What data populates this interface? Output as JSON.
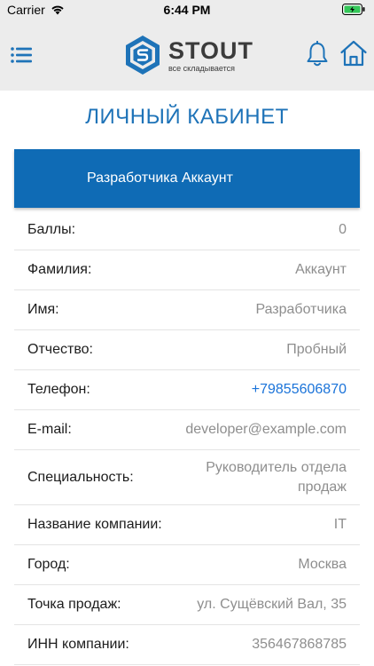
{
  "status_bar": {
    "carrier": "Carrier",
    "time": "6:44 PM"
  },
  "header": {
    "logo_title": "STOUT",
    "logo_subtitle": "все складывается",
    "icons": {
      "menu": "hamburger-menu-icon",
      "bell": "bell-icon",
      "home": "home-icon"
    },
    "colors": {
      "brand_blue": "#1e73b8",
      "header_bg": "#ececec"
    }
  },
  "page": {
    "title": "ЛИЧНЫЙ КАБИНЕТ",
    "banner_name": "Разработчика Аккаунт",
    "banner_color": "#0f6bb5"
  },
  "profile": {
    "fields": [
      {
        "label": "Баллы:",
        "value": "0"
      },
      {
        "label": "Фамилия:",
        "value": "Аккаунт"
      },
      {
        "label": "Имя:",
        "value": "Разработчика"
      },
      {
        "label": "Отчество:",
        "value": "Пробный"
      },
      {
        "label": "Телефон:",
        "value": "+79855606870"
      },
      {
        "label": "E-mail:",
        "value": "developer@example.com"
      },
      {
        "label": "Специальность:",
        "value": "Руководитель отдела продаж"
      },
      {
        "label": "Название компании:",
        "value": "IT"
      },
      {
        "label": "Город:",
        "value": "Москва"
      },
      {
        "label": "Точка продаж:",
        "value": "ул. Сущёвский Вал, 35"
      },
      {
        "label": "ИНН компании:",
        "value": "356467868785"
      }
    ]
  }
}
